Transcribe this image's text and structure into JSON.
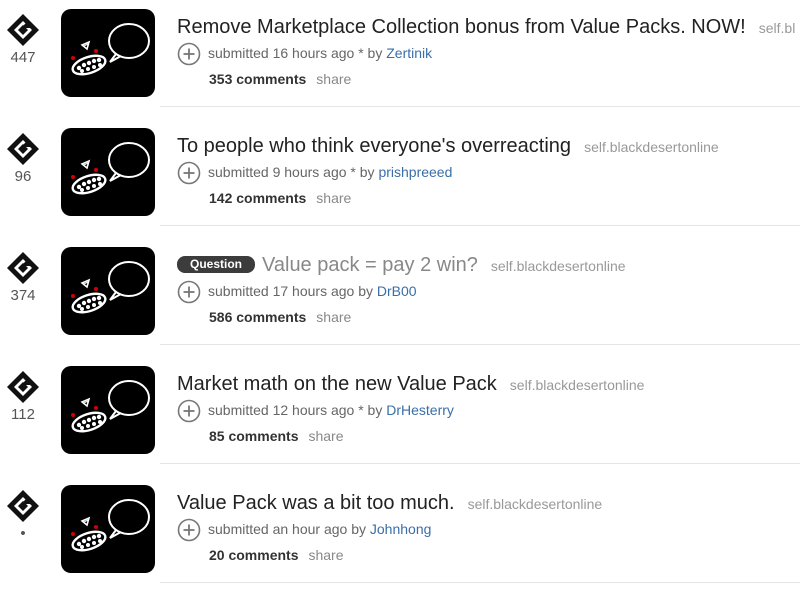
{
  "posts": [
    {
      "score": "447",
      "title": "Remove Marketplace Collection bonus from Value Packs. NOW!",
      "title_visited": false,
      "flair": "",
      "domain": "self.bl",
      "tagline_prefix": "submitted 16 hours ago * by ",
      "author": "Zertinik",
      "comments": "353 comments",
      "share": "share"
    },
    {
      "score": "96",
      "title": "To people who think everyone's overreacting",
      "title_visited": false,
      "flair": "",
      "domain": "self.blackdesertonline",
      "tagline_prefix": "submitted 9 hours ago * by ",
      "author": "prishpreeed",
      "comments": "142 comments",
      "share": "share"
    },
    {
      "score": "374",
      "title": "Value pack = pay 2 win?",
      "title_visited": true,
      "flair": "Question",
      "domain": "self.blackdesertonline",
      "tagline_prefix": "submitted 17 hours ago by ",
      "author": "DrB00",
      "comments": "586 comments",
      "share": "share"
    },
    {
      "score": "112",
      "title": "Market math on the new Value Pack",
      "title_visited": false,
      "flair": "",
      "domain": "self.blackdesertonline",
      "tagline_prefix": "submitted 12 hours ago * by ",
      "author": "DrHesterry",
      "comments": "85 comments",
      "share": "share"
    },
    {
      "score": "•",
      "title": "Value Pack was a bit too much.",
      "title_visited": false,
      "flair": "",
      "domain": "self.blackdesertonline",
      "tagline_prefix": "submitted an hour ago by ",
      "author": "Johnhong",
      "comments": "20 comments",
      "share": "share"
    }
  ],
  "icons": {
    "vote": "diamond-upvote-icon",
    "thumbnail": "speech-bubble-face-thumbnail",
    "expand": "expand-plus-icon"
  },
  "colors": {
    "author_link": "#3a6ea8",
    "flair_bg": "#3c3c3c",
    "thumbnail_bg": "#000000"
  }
}
